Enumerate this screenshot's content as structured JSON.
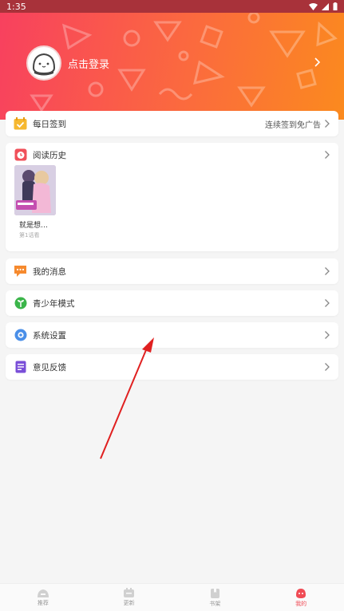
{
  "status_bar": {
    "time": "1:35"
  },
  "header": {
    "login_text": "点击登录"
  },
  "daily_checkin": {
    "label": "每日签到",
    "extra": "连续签到免广告"
  },
  "reading_history": {
    "label": "阅读历史",
    "books": [
      {
        "title": "就是想…",
        "progress": "第1话看"
      }
    ]
  },
  "menu": {
    "messages": "我的消息",
    "teen_mode": "青少年模式",
    "settings": "系统设置",
    "feedback": "意见反馈"
  },
  "tabbar": {
    "items": [
      {
        "label": "推荐",
        "icon": "home-icon",
        "active": false
      },
      {
        "label": "更新",
        "icon": "update-icon",
        "active": false
      },
      {
        "label": "书架",
        "icon": "bookshelf-icon",
        "active": false
      },
      {
        "label": "我的",
        "icon": "profile-icon",
        "active": true
      }
    ]
  },
  "colors": {
    "header_start": "#f8405f",
    "header_end": "#fb8a1e",
    "active_tab": "#f04b55",
    "arrow": "#e02020"
  }
}
